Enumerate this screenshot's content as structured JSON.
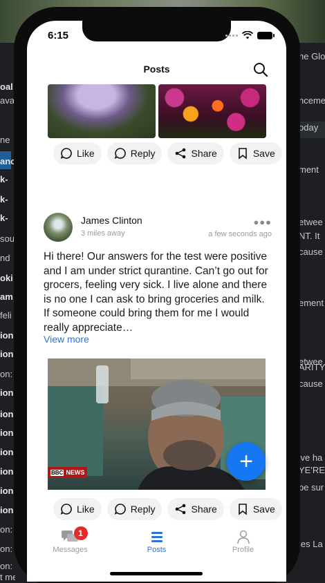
{
  "status_bar": {
    "time": "6:15"
  },
  "header": {
    "title": "Posts"
  },
  "actions": {
    "like": "Like",
    "reply": "Reply",
    "share": "Share",
    "save": "Save"
  },
  "post": {
    "author": "James Clinton",
    "distance": "3 miles away",
    "time_ago": "a few seconds ago",
    "body": "Hi there! Our answers for the test were positive and I am under strict qurantine. Can’t go out for grocers, feeling very sick. I live alone and there is no one I can ask to bring groceries and milk. If someone could bring them for me I would really appreciate…",
    "view_more": "View more",
    "photo_badge": {
      "brand": "BBC",
      "news": "NEWS"
    }
  },
  "tabs": [
    {
      "label": "Messages",
      "badge": "1",
      "icon": "chat-icon"
    },
    {
      "label": "Posts",
      "icon": "list-icon"
    },
    {
      "label": "Profile",
      "icon": "person-icon"
    }
  ],
  "background_window": {
    "left_fragments": [
      "oal l",
      "ava",
      "ne",
      "anc",
      "k-",
      "k-",
      "k-",
      "sou",
      "nd",
      "oki",
      "am",
      "feli",
      "ion",
      "ion",
      "on:",
      "ion",
      "ion",
      "ion",
      "ion",
      "ion",
      "ion",
      "ion",
      "on:",
      "on:",
      "on:",
      "t me"
    ],
    "right_fragments": [
      "he Glo",
      "nceme",
      "oday",
      "ment",
      "etwee",
      "NT. It",
      "cause",
      "ement",
      "etwee",
      "ARITY",
      "cause",
      "'ve ha",
      "YE'RE",
      "be sur",
      "ies La"
    ]
  },
  "colors": {
    "accent": "#2b73d6",
    "fab": "#1677f2",
    "badge": "#e22b2b"
  }
}
